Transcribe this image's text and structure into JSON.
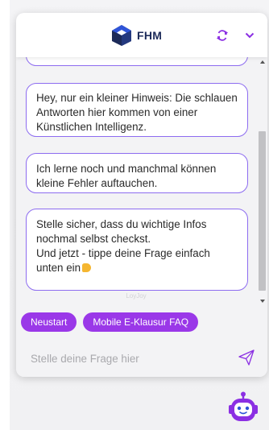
{
  "header": {
    "brand_name": "FHM",
    "logo_icon": "fhm-cube-logo",
    "refresh_icon": "refresh-icon",
    "collapse_icon": "chevron-down-icon"
  },
  "messages": [
    {
      "text": ""
    },
    {
      "text": "Hey, nur ein kleiner Hinweis: Die schlauen Antworten hier kommen von einer Künstlichen Intelligenz."
    },
    {
      "text": "Ich lerne noch und manchmal können kleine Fehler auftauchen."
    },
    {
      "lines": [
        "Stelle sicher, dass du wichtige Infos nochmal selbst checkst.",
        "Und jetzt - tippe deine Frage einfach unten ein"
      ],
      "emoji": "pointing-hand-emoji"
    }
  ],
  "footer_brand": "LoyJoy",
  "quick_replies": [
    "Neustart",
    "Mobile E-Klausur FAQ"
  ],
  "input": {
    "placeholder": "Stelle deine Frage hier",
    "value": ""
  },
  "send_icon": "paper-plane-icon",
  "bot_icon": "chatbot-avatar-icon",
  "colors": {
    "accent": "#9a38e8",
    "bubble_border": "#8d6cf0",
    "brand_text": "#1c2a59",
    "icon_purple": "#8b2fe3"
  }
}
